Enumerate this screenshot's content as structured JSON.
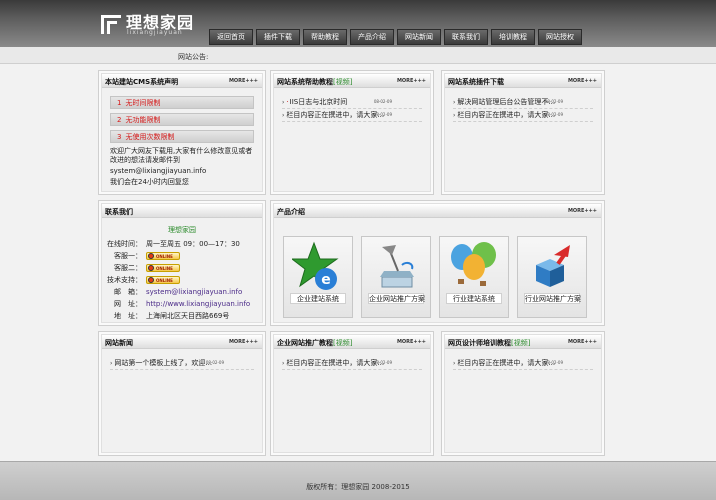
{
  "header": {
    "logo_title": "理想家园",
    "logo_sub": "lixiangjiayuan",
    "nav": [
      "返回首页",
      "插件下载",
      "帮助教程",
      "产品介绍",
      "网站新闻",
      "联系我们",
      "培训教程",
      "网站授权"
    ]
  },
  "notice": {
    "label": "网站公告:"
  },
  "more_label": "MORE+++",
  "cms_panel": {
    "title": "本站建站CMS系统声明",
    "stats": [
      {
        "num": "1",
        "text": "无时间限制"
      },
      {
        "num": "2",
        "text": "无功能限制"
      },
      {
        "num": "3",
        "text": "无使用次数限制"
      }
    ],
    "welcome": "欢迎广大网友下载用,大家有什么修改意见或者改进的想法请发邮件到",
    "email": "system@lixiangjiayuan.info",
    "reply": "我们会在24小时内回复您"
  },
  "help_panel": {
    "title": "网站系统帮助教程",
    "tag": "[视频]",
    "items": [
      {
        "text": "IIS日志与北京时间",
        "date": "08-02-09",
        "pin": true
      },
      {
        "text": "栏目内容正在撰进中，请大家...",
        "date": "08-02-09",
        "pin": false
      }
    ]
  },
  "plugin_panel": {
    "title": "网站系统插件下载",
    "items": [
      {
        "text": "解决网站管理后台公告管理不...",
        "date": "08-02-09"
      },
      {
        "text": "栏目内容正在撰进中，请大家...",
        "date": "08-02-09"
      }
    ]
  },
  "contact_panel": {
    "title": "联系我们",
    "name": "理想家园",
    "rows": [
      {
        "label": "在线时间：",
        "value": "周一至周五 09：00—17：30",
        "type": "text"
      },
      {
        "label": "客服一：",
        "value": "ONLINE",
        "type": "qq"
      },
      {
        "label": "客服二：",
        "value": "ONLINE",
        "type": "qq"
      },
      {
        "label": "技术支持：",
        "value": "ONLINE",
        "type": "qq"
      },
      {
        "label": "邮　箱：",
        "value": "system@lixiangjiayuan.info",
        "type": "link"
      },
      {
        "label": "网　址：",
        "value": "http://www.lixiangjiayuan.info",
        "type": "link"
      },
      {
        "label": "地　址：",
        "value": "上海闸北区天目西路669号",
        "type": "text"
      }
    ]
  },
  "product_panel": {
    "title": "产品介绍",
    "products": [
      {
        "label": "企业建站系统",
        "icon": "star-icon"
      },
      {
        "label": "企业网站推广方案",
        "icon": "lamp-icon"
      },
      {
        "label": "行业建站系统",
        "icon": "balloons-icon"
      },
      {
        "label": "行业网站推广方案",
        "icon": "cubes-icon"
      }
    ]
  },
  "news_panel": {
    "title": "网站新闻",
    "items": [
      {
        "text": "网站第一个模板上线了，欢迎...",
        "date": "08-02-09"
      }
    ]
  },
  "promo_panel": {
    "title": "企业网站推广教程",
    "tag": "[视频]",
    "items": [
      {
        "text": "栏目内容正在撰进中，请大家...",
        "date": "08-02-09"
      }
    ]
  },
  "design_panel": {
    "title": "网页设计师培训教程",
    "tag": "[视频]",
    "items": [
      {
        "text": "栏目内容正在撰进中，请大家...",
        "date": "08-02-09"
      }
    ]
  },
  "footer": {
    "copyright": "版权所有：理想家园 2008-2015"
  }
}
